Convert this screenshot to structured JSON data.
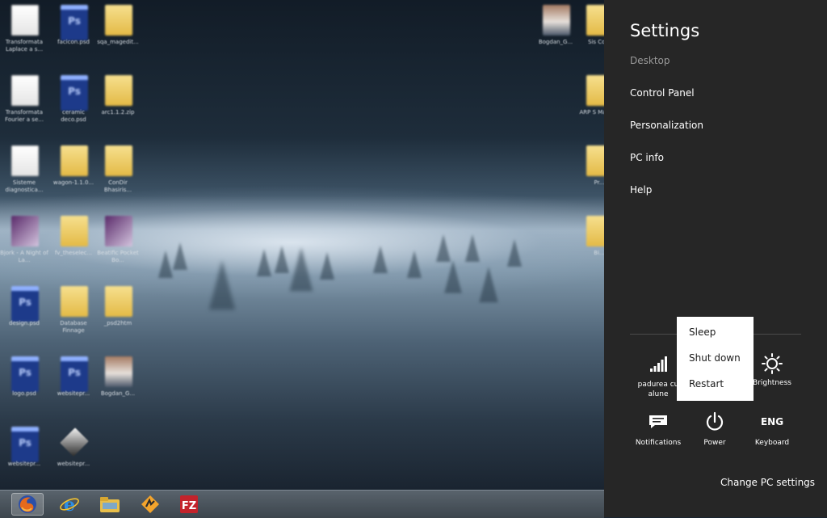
{
  "desktop": {
    "icons": [
      {
        "type": "doc",
        "label": "Transformata Laplace a s..."
      },
      {
        "type": "ps",
        "label": "facicon.psd"
      },
      {
        "type": "folder",
        "label": "sqa_magedit..."
      },
      {
        "type": "doc",
        "label": "Transformata Fourier a se..."
      },
      {
        "type": "ps",
        "label": "ceramic deco.psd"
      },
      {
        "type": "folder",
        "label": "arc1.1.2.zip"
      },
      {
        "type": "doc",
        "label": "Sisteme diagnostica..."
      },
      {
        "type": "folder",
        "label": "wagon-1.1.0..."
      },
      {
        "type": "folder",
        "label": "ConDir Bhasiris..."
      },
      {
        "type": "book",
        "label": "Bjork - A Night of La..."
      },
      {
        "type": "folder",
        "label": "fv_theselec..."
      },
      {
        "type": "book",
        "label": "Beatific Pocket Bo..."
      },
      {
        "type": "ps",
        "label": "design.psd"
      },
      {
        "type": "folder",
        "label": "Database Finnage"
      },
      {
        "type": "folder",
        "label": "_psd2htm"
      },
      {
        "type": "ps",
        "label": "logo.psd"
      },
      {
        "type": "ps",
        "label": "websitepr..."
      },
      {
        "type": "photo",
        "label": "Bogdan_G..."
      },
      {
        "type": "ps",
        "label": "websitepr..."
      },
      {
        "type": "gem",
        "label": "websitepr..."
      },
      {
        "type": "photo",
        "label": "Bogdan_G..."
      },
      {
        "type": "folder",
        "label": "Sis Co..."
      },
      {
        "type": "folder",
        "label": "ARP S Mater..."
      },
      {
        "type": "folder",
        "label": "Pr..."
      },
      {
        "type": "folder",
        "label": "Bi..."
      }
    ]
  },
  "taskbar": {
    "apps": [
      {
        "name": "Firefox",
        "active": true
      },
      {
        "name": "Internet Explorer",
        "active": false
      },
      {
        "name": "File Explorer",
        "active": false
      },
      {
        "name": "Winamp",
        "active": false
      },
      {
        "name": "FileZilla",
        "active": false
      }
    ]
  },
  "charm": {
    "title": "Settings",
    "subtitle": "Desktop",
    "links": [
      "Control Panel",
      "Personalization",
      "PC info",
      "Help"
    ],
    "tiles": {
      "network_label": "padurea cu alune",
      "brightness_label": "Brightness",
      "notifications_label": "Notifications",
      "power_label": "Power",
      "keyboard_label": "Keyboard",
      "keyboard_text": "ENG"
    },
    "power_menu": [
      "Sleep",
      "Shut down",
      "Restart"
    ],
    "change_settings": "Change PC settings"
  }
}
